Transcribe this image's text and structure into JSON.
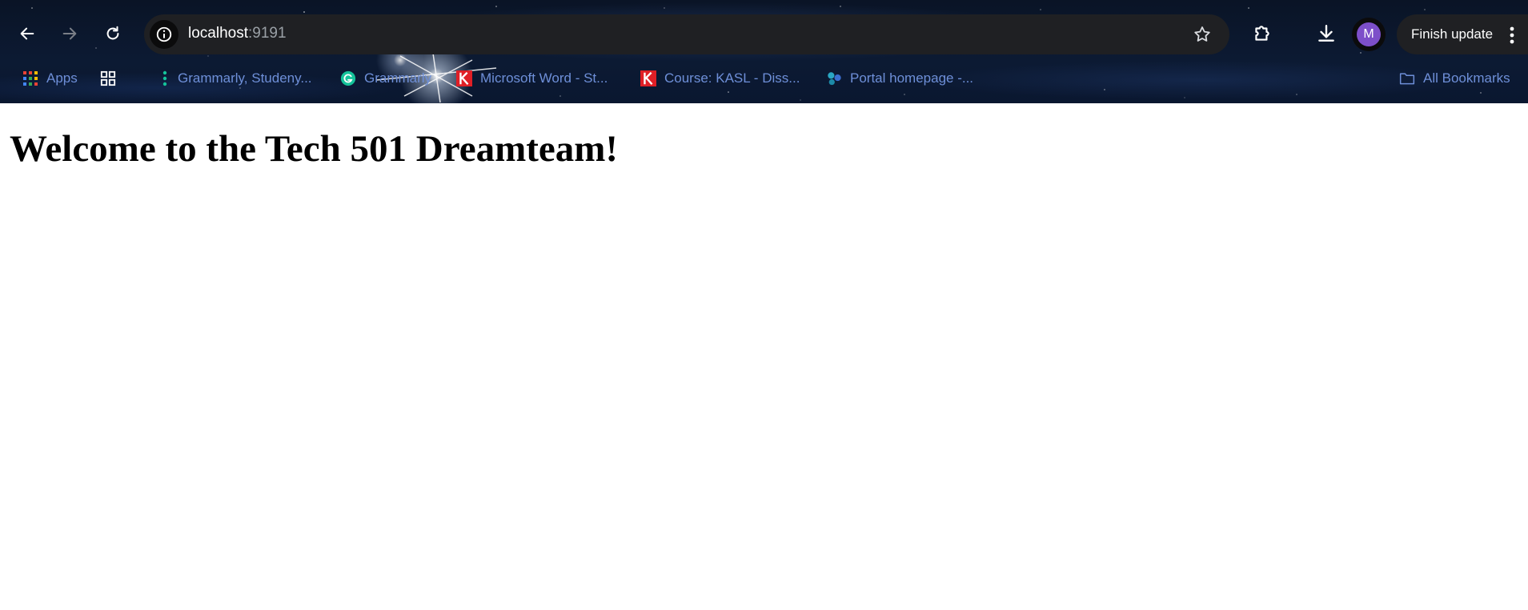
{
  "browser": {
    "url_host": "localhost",
    "url_port": ":9191",
    "finish_update_label": "Finish update",
    "profile_initial": "M"
  },
  "bookmarks": {
    "items": [
      {
        "label": "Apps",
        "icon": "apps-grid-icon"
      },
      {
        "label": "",
        "icon": "tab-groups-icon"
      },
      {
        "label": "Grammarly, Studeny...",
        "icon": "grammarly-dots-icon"
      },
      {
        "label": "Grammarly",
        "icon": "grammarly-logo-icon"
      },
      {
        "label": "Microsoft Word - St...",
        "icon": "k-logo-icon"
      },
      {
        "label": "Course: KASL - Diss...",
        "icon": "k-logo-icon"
      },
      {
        "label": "Portal homepage -...",
        "icon": "portal-icon"
      }
    ],
    "all_bookmarks_label": "All Bookmarks"
  },
  "page": {
    "heading": "Welcome to the Tech 501 Dreamteam!"
  },
  "colors": {
    "bookmark_text": "#6e8fd8",
    "omnibox_bg": "#1f2023",
    "avatar_bg": "#7d4fc9",
    "k_logo": "#e01f26"
  }
}
